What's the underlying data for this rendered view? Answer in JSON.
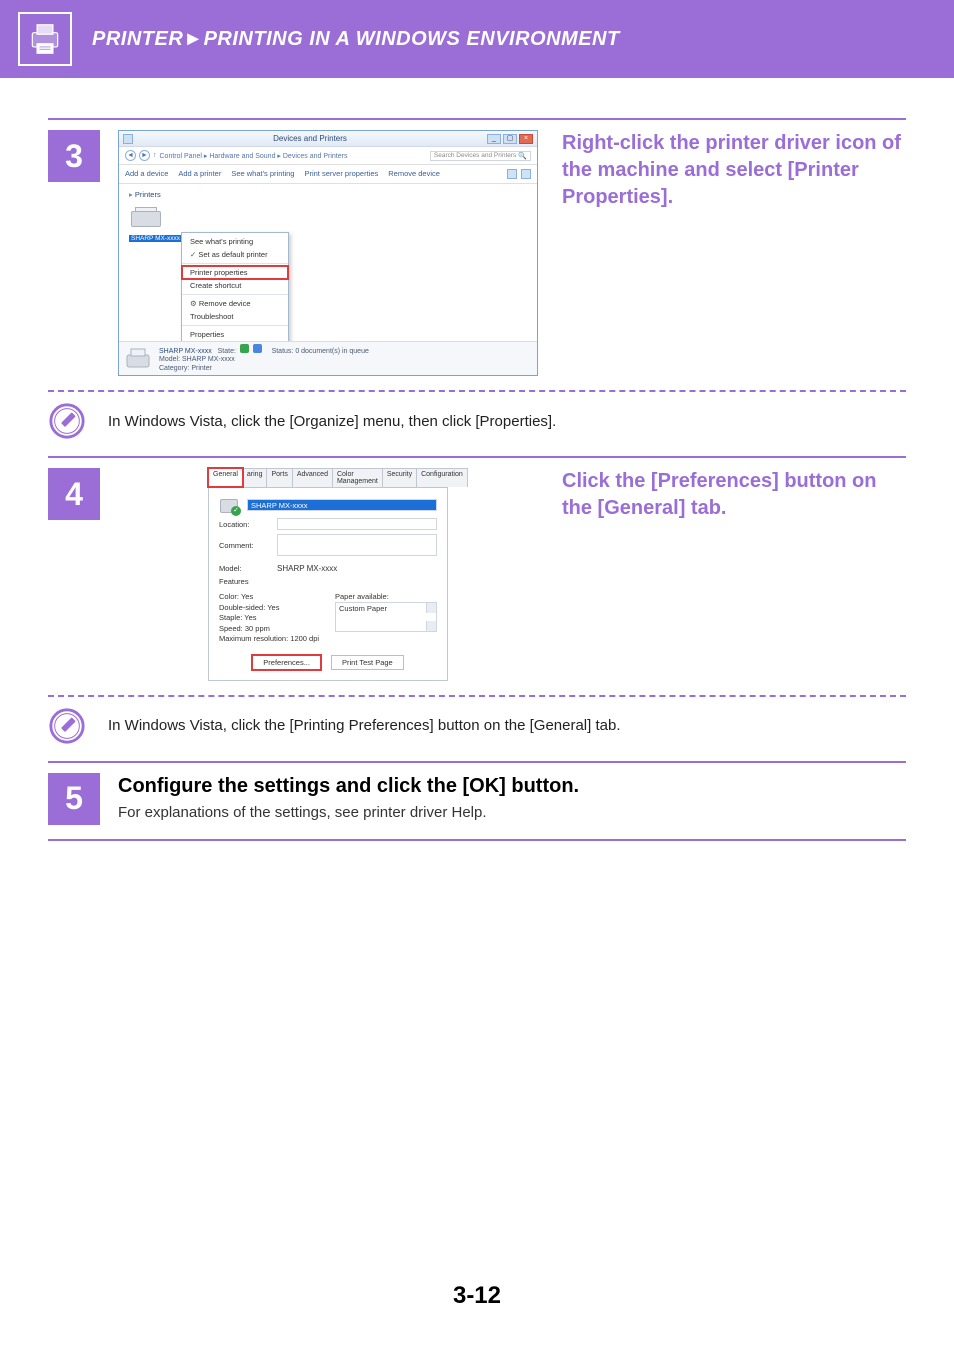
{
  "header": {
    "breadcrumb": "PRINTER►PRINTING IN A WINDOWS ENVIRONMENT"
  },
  "step3": {
    "number": "3",
    "heading": "Right-click the printer driver icon of the machine and select [Printer Properties].",
    "shot": {
      "title": "Devices and Printers",
      "back_icon": "back",
      "crumb": "Control Panel  ▸  Hardware and Sound  ▸  Devices and Printers",
      "search_placeholder": "Search Devices and Printers",
      "toolbar": {
        "add_device": "Add a device",
        "add_printer": "Add a printer",
        "see_whats_printing": "See what's printing",
        "print_server_properties": "Print server properties",
        "remove_device": "Remove device"
      },
      "section_label": "Printers",
      "printer_name": "SHARP MX-xxxx",
      "context_menu": {
        "see_printing": "See what's printing",
        "set_default": "Set as default printer",
        "printer_properties": "Printer properties",
        "create_shortcut": "Create shortcut",
        "remove_device": "Remove device",
        "troubleshoot": "Troubleshoot",
        "properties": "Properties"
      },
      "status": {
        "name": "SHARP MX-xxxx",
        "state_label": "State:",
        "model_label": "Model:",
        "model": "SHARP MX-xxxx",
        "category_label": "Category:",
        "category": "Printer",
        "queue_label": "Status:",
        "queue": "0 document(s) in queue"
      }
    },
    "note": "In Windows Vista, click the [Organize] menu, then click [Properties]."
  },
  "step4": {
    "number": "4",
    "heading": "Click the [Preferences] button on the [General] tab.",
    "shot": {
      "tabs": {
        "general": "General",
        "sharing": "aring",
        "ports": "Ports",
        "advanced": "Advanced",
        "color": "Color Management",
        "security": "Security",
        "config": "Configuration"
      },
      "printer_name": "SHARP MX-xxxx",
      "location_label": "Location:",
      "comment_label": "Comment:",
      "model_label": "Model:",
      "model": "SHARP MX-xxxx",
      "features_label": "Features",
      "features": {
        "color": "Color: Yes",
        "double": "Double-sided: Yes",
        "staple": "Staple: Yes",
        "speed": "Speed: 30 ppm",
        "maxres": "Maximum resolution: 1200 dpi"
      },
      "paper_label": "Paper available:",
      "paper_item": "Custom Paper",
      "buttons": {
        "prefs": "Preferences...",
        "test": "Print Test Page"
      }
    },
    "note": "In Windows Vista, click the [Printing Preferences] button on the [General] tab."
  },
  "step5": {
    "number": "5",
    "heading": "Configure the settings and click the [OK] button.",
    "sub": "For explanations of the settings, see printer driver Help."
  },
  "footer": {
    "page": "3-12"
  }
}
